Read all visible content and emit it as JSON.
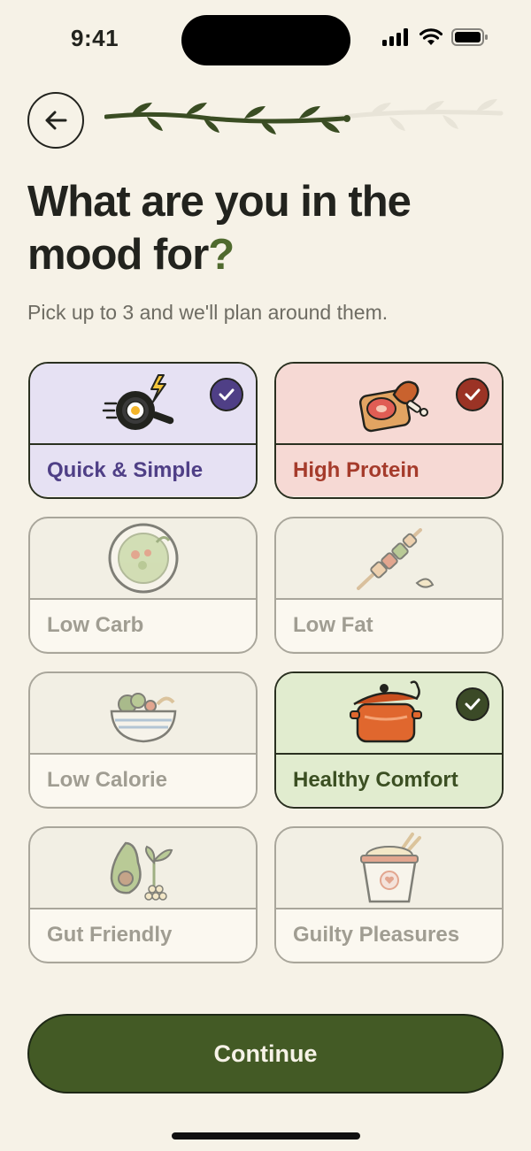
{
  "status": {
    "time": "9:41"
  },
  "header": {
    "title_main": "What are you in the mood for",
    "title_mark": "?",
    "subtitle": "Pick up to 3 and we'll plan around them."
  },
  "progress": {
    "fraction": 0.62
  },
  "options": [
    {
      "label": "Quick & Simple",
      "selected": true,
      "icon": "frying-pan-egg-icon"
    },
    {
      "label": "High Protein",
      "selected": true,
      "icon": "meat-drumstick-icon"
    },
    {
      "label": "Low Carb",
      "selected": false,
      "icon": "salad-plate-icon"
    },
    {
      "label": "Low Fat",
      "selected": false,
      "icon": "skewer-icon"
    },
    {
      "label": "Low Calorie",
      "selected": false,
      "icon": "salad-bowl-icon"
    },
    {
      "label": "Healthy Comfort",
      "selected": true,
      "icon": "stew-pot-icon"
    },
    {
      "label": "Gut Friendly",
      "selected": false,
      "icon": "avocado-sprout-icon"
    },
    {
      "label": "Guilty Pleasures",
      "selected": false,
      "icon": "noodle-cup-icon"
    }
  ],
  "actions": {
    "continue_label": "Continue"
  },
  "colors": {
    "background": "#f6f2e7",
    "primary": "#435a25",
    "purple": "#4f3f86",
    "red": "#a53b2b",
    "green": "#3b4f22"
  }
}
